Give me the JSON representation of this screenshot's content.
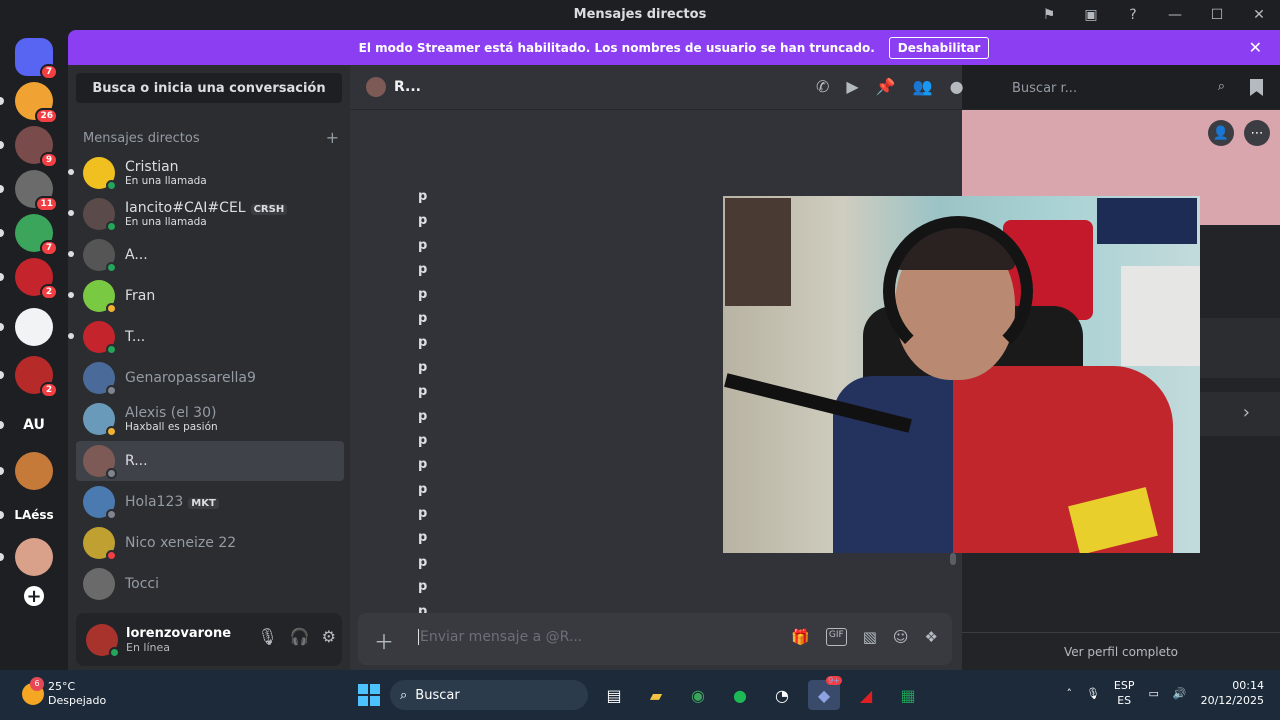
{
  "window": {
    "title": "Mensajes directos",
    "icons": [
      "flag-icon",
      "screen-share-icon",
      "help-icon",
      "minimize-icon",
      "maximize-icon",
      "close-icon"
    ]
  },
  "banner": {
    "text": "El modo Streamer está habilitado. Los nombres de usuario se han truncado.",
    "button_label": "Deshabilitar",
    "close_glyph": "✕"
  },
  "guilds": [
    {
      "label": "",
      "badge": "7",
      "color": "#5865f2"
    },
    {
      "label": "",
      "badge": "26",
      "color": "#f0a232"
    },
    {
      "label": "",
      "badge": "9",
      "color": "#7a4b4b"
    },
    {
      "label": "",
      "badge": "11",
      "color": "#6b6b6b"
    },
    {
      "label": "",
      "badge": "7",
      "color": "#3ba55c"
    },
    {
      "label": "",
      "badge": "2",
      "color": "#c4242b"
    },
    {
      "label": "",
      "badge": "",
      "color": "#f2f3f5"
    },
    {
      "label": "",
      "badge": "2",
      "color": "#b72a2a"
    },
    {
      "label": "AU",
      "badge": "",
      "color": "#1e1f22"
    },
    {
      "label": "",
      "badge": "",
      "color": "#c67a3a"
    },
    {
      "label": "LAéss",
      "badge": "",
      "color": "#1e1f22"
    },
    {
      "label": "",
      "badge": "",
      "color": "#d9a08a"
    },
    {
      "label": "+",
      "badge": "",
      "color": "#1e1f22"
    }
  ],
  "sidebar": {
    "search_label": "Busca o inicia una conversación",
    "section_title": "Mensajes directos",
    "add_glyph": "+",
    "dms": [
      {
        "name": "Cristian",
        "sub": "En una llamada",
        "tag": "",
        "status": "#23a55a",
        "avatar": "#f0c020",
        "dim": false,
        "unread": true
      },
      {
        "name": "Iancito#CAI#CEL",
        "sub": "En una llamada",
        "tag": "CRSH",
        "status": "#23a55a",
        "avatar": "#5a4a4a",
        "dim": false,
        "unread": true
      },
      {
        "name": "A...",
        "sub": "",
        "tag": "",
        "status": "#23a55a",
        "avatar": "#555",
        "dim": false,
        "unread": true
      },
      {
        "name": "Fran",
        "sub": "",
        "tag": "",
        "status": "#f0b232",
        "avatar": "#7ac943",
        "dim": false,
        "unread": true
      },
      {
        "name": "T...",
        "sub": "",
        "tag": "",
        "status": "#23a55a",
        "avatar": "#c4242b",
        "dim": false,
        "unread": true
      },
      {
        "name": "Genaropassarella9",
        "sub": "",
        "tag": "",
        "status": "#80848e",
        "avatar": "#4a6a9a",
        "dim": true,
        "unread": false
      },
      {
        "name": "Alexis (el 30)",
        "sub": "Haxball es pasión",
        "tag": "",
        "status": "#f0b232",
        "avatar": "#6a9aba",
        "dim": true,
        "unread": false
      },
      {
        "name": "R...",
        "sub": "",
        "tag": "",
        "status": "#80848e",
        "avatar": "#7d5a55",
        "dim": false,
        "unread": false
      },
      {
        "name": "Hola123",
        "sub": "",
        "tag": "MKT",
        "status": "#80848e",
        "avatar": "#4a7ab0",
        "dim": true,
        "unread": false
      },
      {
        "name": "Nico xeneize 22",
        "sub": "",
        "tag": "",
        "status": "#f23f43",
        "avatar": "#c0a030",
        "dim": true,
        "unread": false
      },
      {
        "name": "Tocci",
        "sub": "",
        "tag": "",
        "status": "",
        "avatar": "#6a6a6a",
        "dim": true,
        "unread": false
      }
    ]
  },
  "user": {
    "name": "lorenzovarone",
    "status": "En línea",
    "icons": [
      "microphone-icon",
      "headphones-icon",
      "settings-icon"
    ]
  },
  "chat": {
    "recipient": "R...",
    "search_placeholder": "Buscar r...",
    "header_icons": [
      "voice-call-icon",
      "video-call-icon",
      "pinned-icon",
      "add-friend-icon",
      "user-profile-icon"
    ],
    "messages": [
      "p",
      "p",
      "p",
      "p",
      "p",
      "p",
      "p",
      "p",
      "p",
      "p",
      "p",
      "p",
      "p",
      "p",
      "p",
      "p",
      "p",
      "p"
    ],
    "composer_placeholder": "Enviar mensaje a @R...",
    "composer_icons": [
      "gift-icon",
      "gif-icon",
      "sticker-icon",
      "emoji-icon",
      "apps-icon"
    ]
  },
  "profile": {
    "footer_label": "Ver perfil completo",
    "banner_color": "#d9a6ad"
  },
  "taskbar": {
    "weather_badge": "6",
    "temperature": "25°C",
    "condition": "Despejado",
    "search_label": "Buscar",
    "lang_top": "ESP",
    "lang_bottom": "ES",
    "time": "00:14",
    "date": "20/12/2025",
    "app_badge": "9+"
  },
  "colors": {
    "accent": "#8c3ff2",
    "online": "#23a55a",
    "idle": "#f0b232",
    "dnd": "#f23f43"
  }
}
